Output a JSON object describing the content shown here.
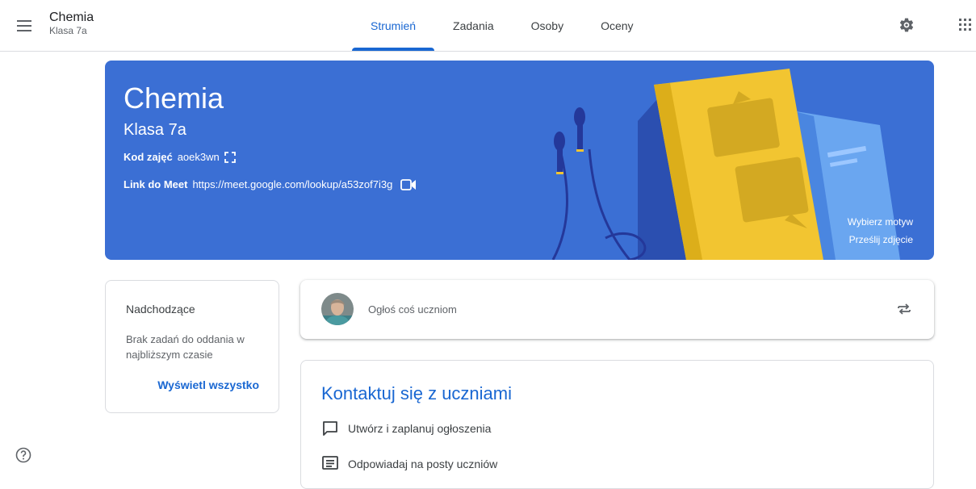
{
  "header": {
    "class_name": "Chemia",
    "class_section": "Klasa 7a",
    "tabs": [
      {
        "label": "Strumień",
        "active": true
      },
      {
        "label": "Zadania",
        "active": false
      },
      {
        "label": "Osoby",
        "active": false
      },
      {
        "label": "Oceny",
        "active": false
      }
    ],
    "icons": {
      "menu": "hamburger-menu-icon",
      "settings": "gear-icon",
      "apps": "apps-grid-icon"
    }
  },
  "banner": {
    "title": "Chemia",
    "section": "Klasa 7a",
    "code_label": "Kod zajęć",
    "code_value": "aoek3wn",
    "meet_label": "Link do Meet",
    "meet_url": "https://meet.google.com/lookup/a53zof7i3g",
    "select_theme": "Wybierz motyw",
    "upload_photo": "Prześlij zdjęcie",
    "color": "#3b6fd4"
  },
  "upcoming": {
    "heading": "Nadchodzące",
    "empty_text": "Brak zadań do oddania w najbliższym czasie",
    "view_all": "Wyświetl wszystko"
  },
  "announce": {
    "placeholder": "Ogłoś coś uczniom"
  },
  "contact": {
    "heading": "Kontaktuj się z uczniami",
    "items": [
      {
        "label": "Utwórz i zaplanuj ogłoszenia",
        "icon": "chat-bubble-icon"
      },
      {
        "label": "Odpowiadaj na posty uczniów",
        "icon": "message-list-icon"
      }
    ]
  },
  "colors": {
    "accent": "#1967d2",
    "banner": "#3b6fd4"
  }
}
